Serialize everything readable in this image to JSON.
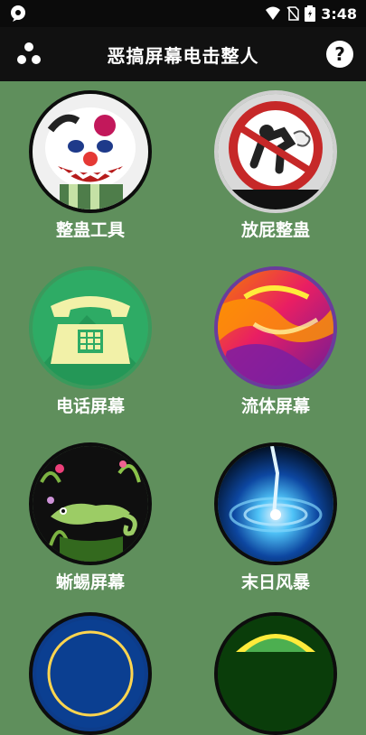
{
  "status_bar": {
    "time": "3:48",
    "icons": [
      "notification-bubble-icon",
      "wifi-icon",
      "no-sim-icon",
      "battery-icon"
    ]
  },
  "app_bar": {
    "title": "恶搞屏幕电击整人",
    "menu_icon": "dots-menu-icon",
    "help_icon": "help-icon",
    "help_symbol": "?"
  },
  "tiles": [
    {
      "label": "整蛊工具",
      "icon": "clown-icon"
    },
    {
      "label": "放屁整蛊",
      "icon": "fart-sign-icon"
    },
    {
      "label": "电话屏幕",
      "icon": "telephone-icon"
    },
    {
      "label": "流体屏幕",
      "icon": "fluid-colors-icon"
    },
    {
      "label": "蜥蜴屏幕",
      "icon": "lizard-icon"
    },
    {
      "label": "末日风暴",
      "icon": "galaxy-storm-icon"
    }
  ],
  "colors": {
    "background": "#5f8f5c",
    "app_bar": "#111111",
    "status_bar": "#0b0b0b"
  }
}
